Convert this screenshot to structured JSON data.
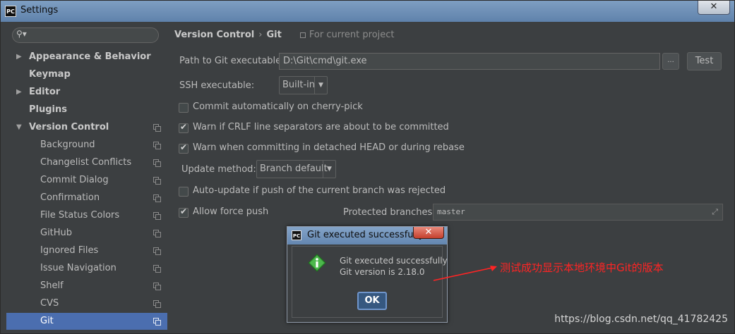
{
  "window": {
    "title": "Settings",
    "app_icon": "PC",
    "close_glyph": "✕"
  },
  "sidebar": {
    "search_icon": "search-icon",
    "search_glyph": "⚲▾",
    "items": [
      {
        "label": "Appearance & Behavior",
        "arrow": "▶",
        "bold": true
      },
      {
        "label": "Keymap",
        "bold": true
      },
      {
        "label": "Editor",
        "arrow": "▶",
        "bold": true
      },
      {
        "label": "Plugins",
        "bold": true
      },
      {
        "label": "Version Control",
        "arrow": "▼",
        "bold": true
      },
      {
        "label": "Background"
      },
      {
        "label": "Changelist Conflicts"
      },
      {
        "label": "Commit Dialog"
      },
      {
        "label": "Confirmation"
      },
      {
        "label": "File Status Colors"
      },
      {
        "label": "GitHub"
      },
      {
        "label": "Ignored Files"
      },
      {
        "label": "Issue Navigation"
      },
      {
        "label": "Shelf"
      },
      {
        "label": "CVS"
      },
      {
        "label": "Git",
        "selected": true
      }
    ]
  },
  "breadcrumb": {
    "section": "Version Control",
    "separator": "›",
    "page": "Git",
    "scope": "For current project"
  },
  "form": {
    "path_label": "Path to Git executable:",
    "path_value": "D:\\Git\\cmd\\git.exe",
    "browse_label": "...",
    "test_label": "Test",
    "ssh_label": "SSH executable:",
    "ssh_value": "Built-in",
    "commit_cherry_label": "Commit automatically on cherry-pick",
    "commit_cherry_checked": false,
    "warn_crlf_label": "Warn if CRLF line separators are about to be committed",
    "warn_crlf_checked": true,
    "warn_detached_label": "Warn when committing in detached HEAD or during rebase",
    "warn_detached_checked": true,
    "update_method_label": "Update method:",
    "update_method_value": "Branch default",
    "auto_update_label": "Auto-update if push of the current branch was rejected",
    "auto_update_checked": false,
    "allow_force_label": "Allow force push",
    "allow_force_checked": true,
    "protected_label": "Protected branches:",
    "protected_value": "master",
    "combo_arrow": "▼",
    "expand_glyph": "⤢"
  },
  "dialog": {
    "title": "Git executed successfully",
    "close_glyph": "✕",
    "message_line1": "Git executed successfully",
    "message_line2": "Git version is 2.18.0",
    "ok_label": "OK",
    "icon": "info-icon"
  },
  "annotation": {
    "text": "测试成功显示本地环境中Git的版本",
    "color": "#ff2424"
  },
  "watermark": "https://blog.csdn.net/qq_41782425",
  "colors": {
    "selected": "#4b6eaf",
    "background": "#3c3f41",
    "titlebar": "#6a8bb0"
  }
}
